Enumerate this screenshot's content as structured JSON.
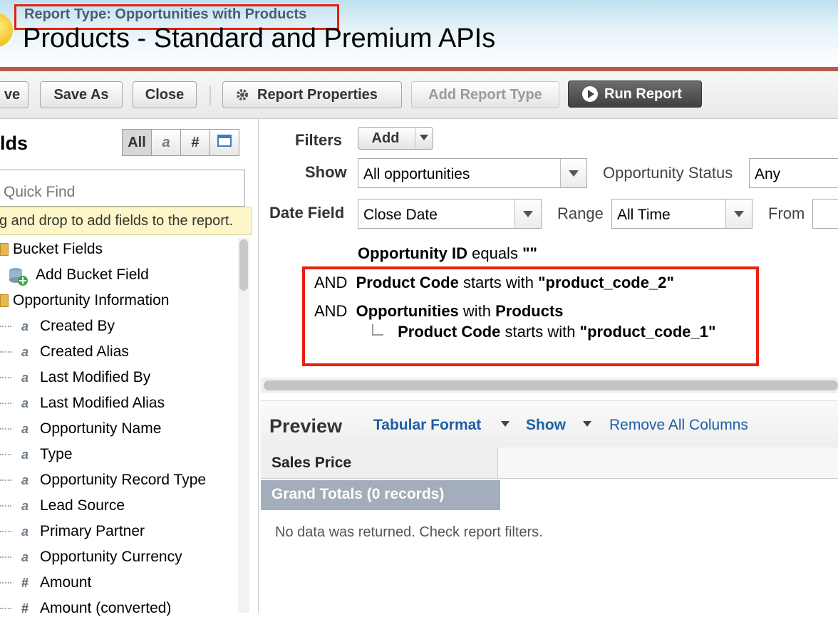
{
  "header": {
    "report_type": "Report Type: Opportunities with Products",
    "title": "Products - Standard and Premium APIs"
  },
  "toolbar": {
    "save_label": "ve",
    "save_as_label": "Save As",
    "close_label": "Close",
    "report_properties_label": "Report Properties",
    "add_report_type_label": "Add Report Type",
    "run_report_label": "Run Report"
  },
  "fields_panel": {
    "heading": "lds",
    "filter_all": "All",
    "filter_text_icon": "a",
    "filter_number_icon": "#",
    "quick_find_placeholder": "Quick Find",
    "tip": "g and drop to add fields to the report.",
    "tree": [
      {
        "label": "Bucket Fields",
        "icon": "folder-icon"
      },
      {
        "label": "Add Bucket Field",
        "icon": "add-bucket-icon"
      },
      {
        "label": "Opportunity Information",
        "icon": "folder-icon"
      },
      {
        "label": "Created By",
        "icon": "text-field-icon"
      },
      {
        "label": "Created Alias",
        "icon": "text-field-icon"
      },
      {
        "label": "Last Modified By",
        "icon": "text-field-icon"
      },
      {
        "label": "Last Modified Alias",
        "icon": "text-field-icon"
      },
      {
        "label": "Opportunity Name",
        "icon": "text-field-icon"
      },
      {
        "label": "Type",
        "icon": "text-field-icon"
      },
      {
        "label": "Opportunity Record Type",
        "icon": "text-field-icon"
      },
      {
        "label": "Lead Source",
        "icon": "text-field-icon"
      },
      {
        "label": "Primary Partner",
        "icon": "text-field-icon"
      },
      {
        "label": "Opportunity Currency",
        "icon": "text-field-icon"
      },
      {
        "label": "Amount",
        "icon": "number-field-icon"
      },
      {
        "label": "Amount (converted)",
        "icon": "number-field-icon"
      }
    ]
  },
  "filters": {
    "label": "Filters",
    "add_label": "Add",
    "show_label": "Show",
    "show_value": "All opportunities",
    "status_label": "Opportunity Status",
    "status_value": "Any",
    "date_field_label": "Date Field",
    "date_field_value": "Close Date",
    "range_label": "Range",
    "range_value": "All Time",
    "from_label": "From",
    "conditions": {
      "c1": {
        "field": "Opportunity ID",
        "op": "equals",
        "value": "\"\""
      },
      "c2": {
        "prefix": "AND",
        "field": "Product Code",
        "op": "starts with",
        "value": "\"product_code_2\""
      },
      "c3": {
        "prefix": "AND",
        "object": "Opportunities",
        "with": "with",
        "related": "Products"
      },
      "c4": {
        "field": "Product Code",
        "op": "starts with",
        "value": "\"product_code_1\""
      }
    }
  },
  "preview": {
    "title": "Preview",
    "format_label": "Tabular Format",
    "show_label": "Show",
    "remove_columns_label": "Remove All Columns",
    "column_header": "Sales Price",
    "grand_totals": "Grand Totals (0 records)",
    "no_data": "No data was returned. Check report filters."
  },
  "colors": {
    "highlight": "#e8200f",
    "link": "#1b5fa5",
    "grand_totals_bg": "#a4adbc",
    "header_rule": "#b55a4c"
  }
}
